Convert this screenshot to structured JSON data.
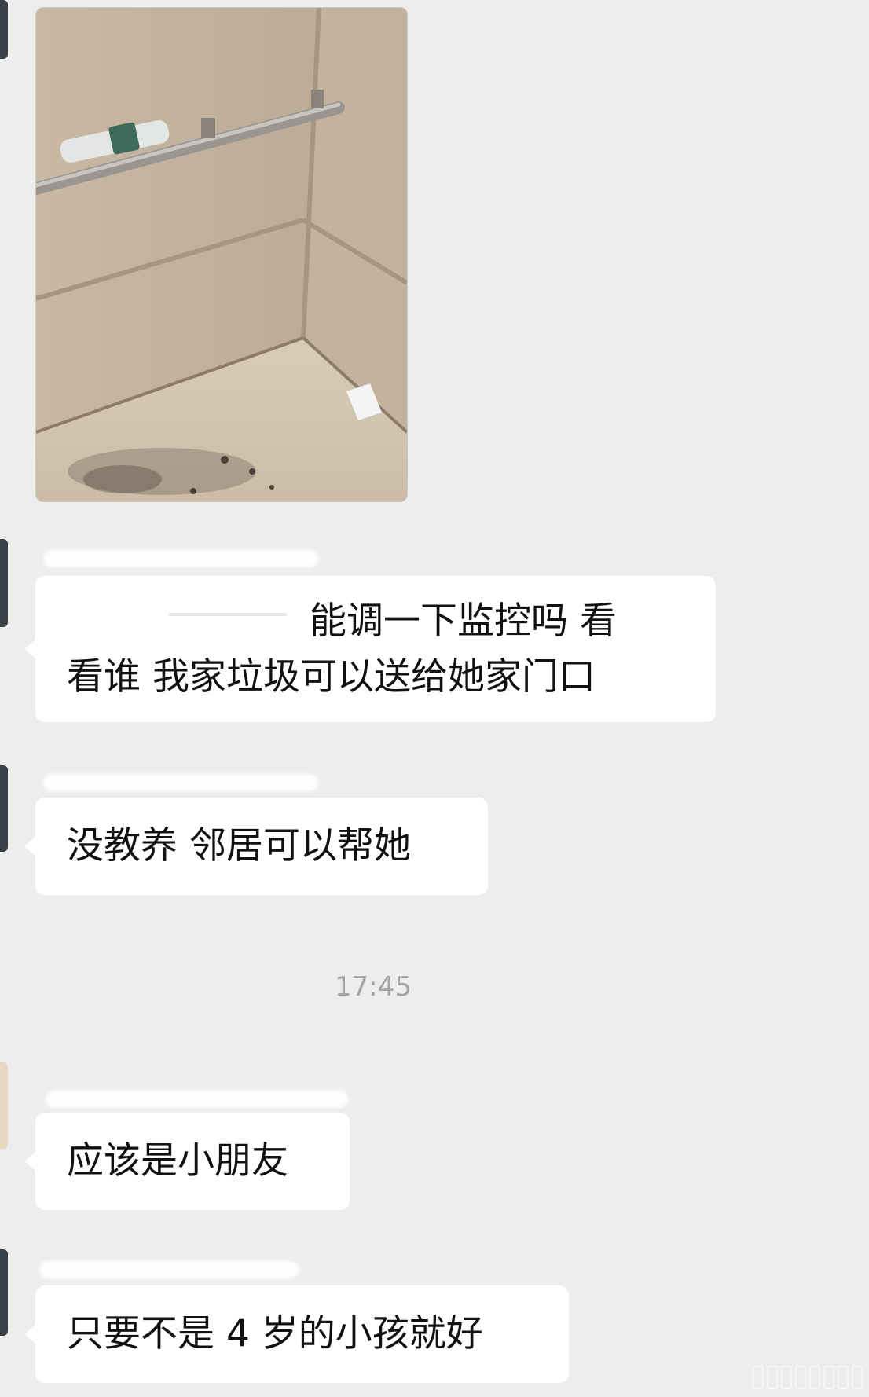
{
  "chat": {
    "messages": [
      {
        "kind": "image",
        "alt": ""
      },
      {
        "kind": "text",
        "line1": "能调一下监控吗 看",
        "line2": "看谁 我家垃圾可以送给她家门口"
      },
      {
        "kind": "text",
        "text": "没教养 邻居可以帮她"
      },
      {
        "kind": "text",
        "text": "应该是小朋友"
      },
      {
        "kind": "text",
        "text": "只要不是 4 岁的小孩就好"
      }
    ],
    "timestamp": "17:45"
  },
  "colors": {
    "background": "#ededed",
    "bubble": "#ffffff",
    "text": "#111111",
    "timestamp": "#a4a4a4"
  }
}
